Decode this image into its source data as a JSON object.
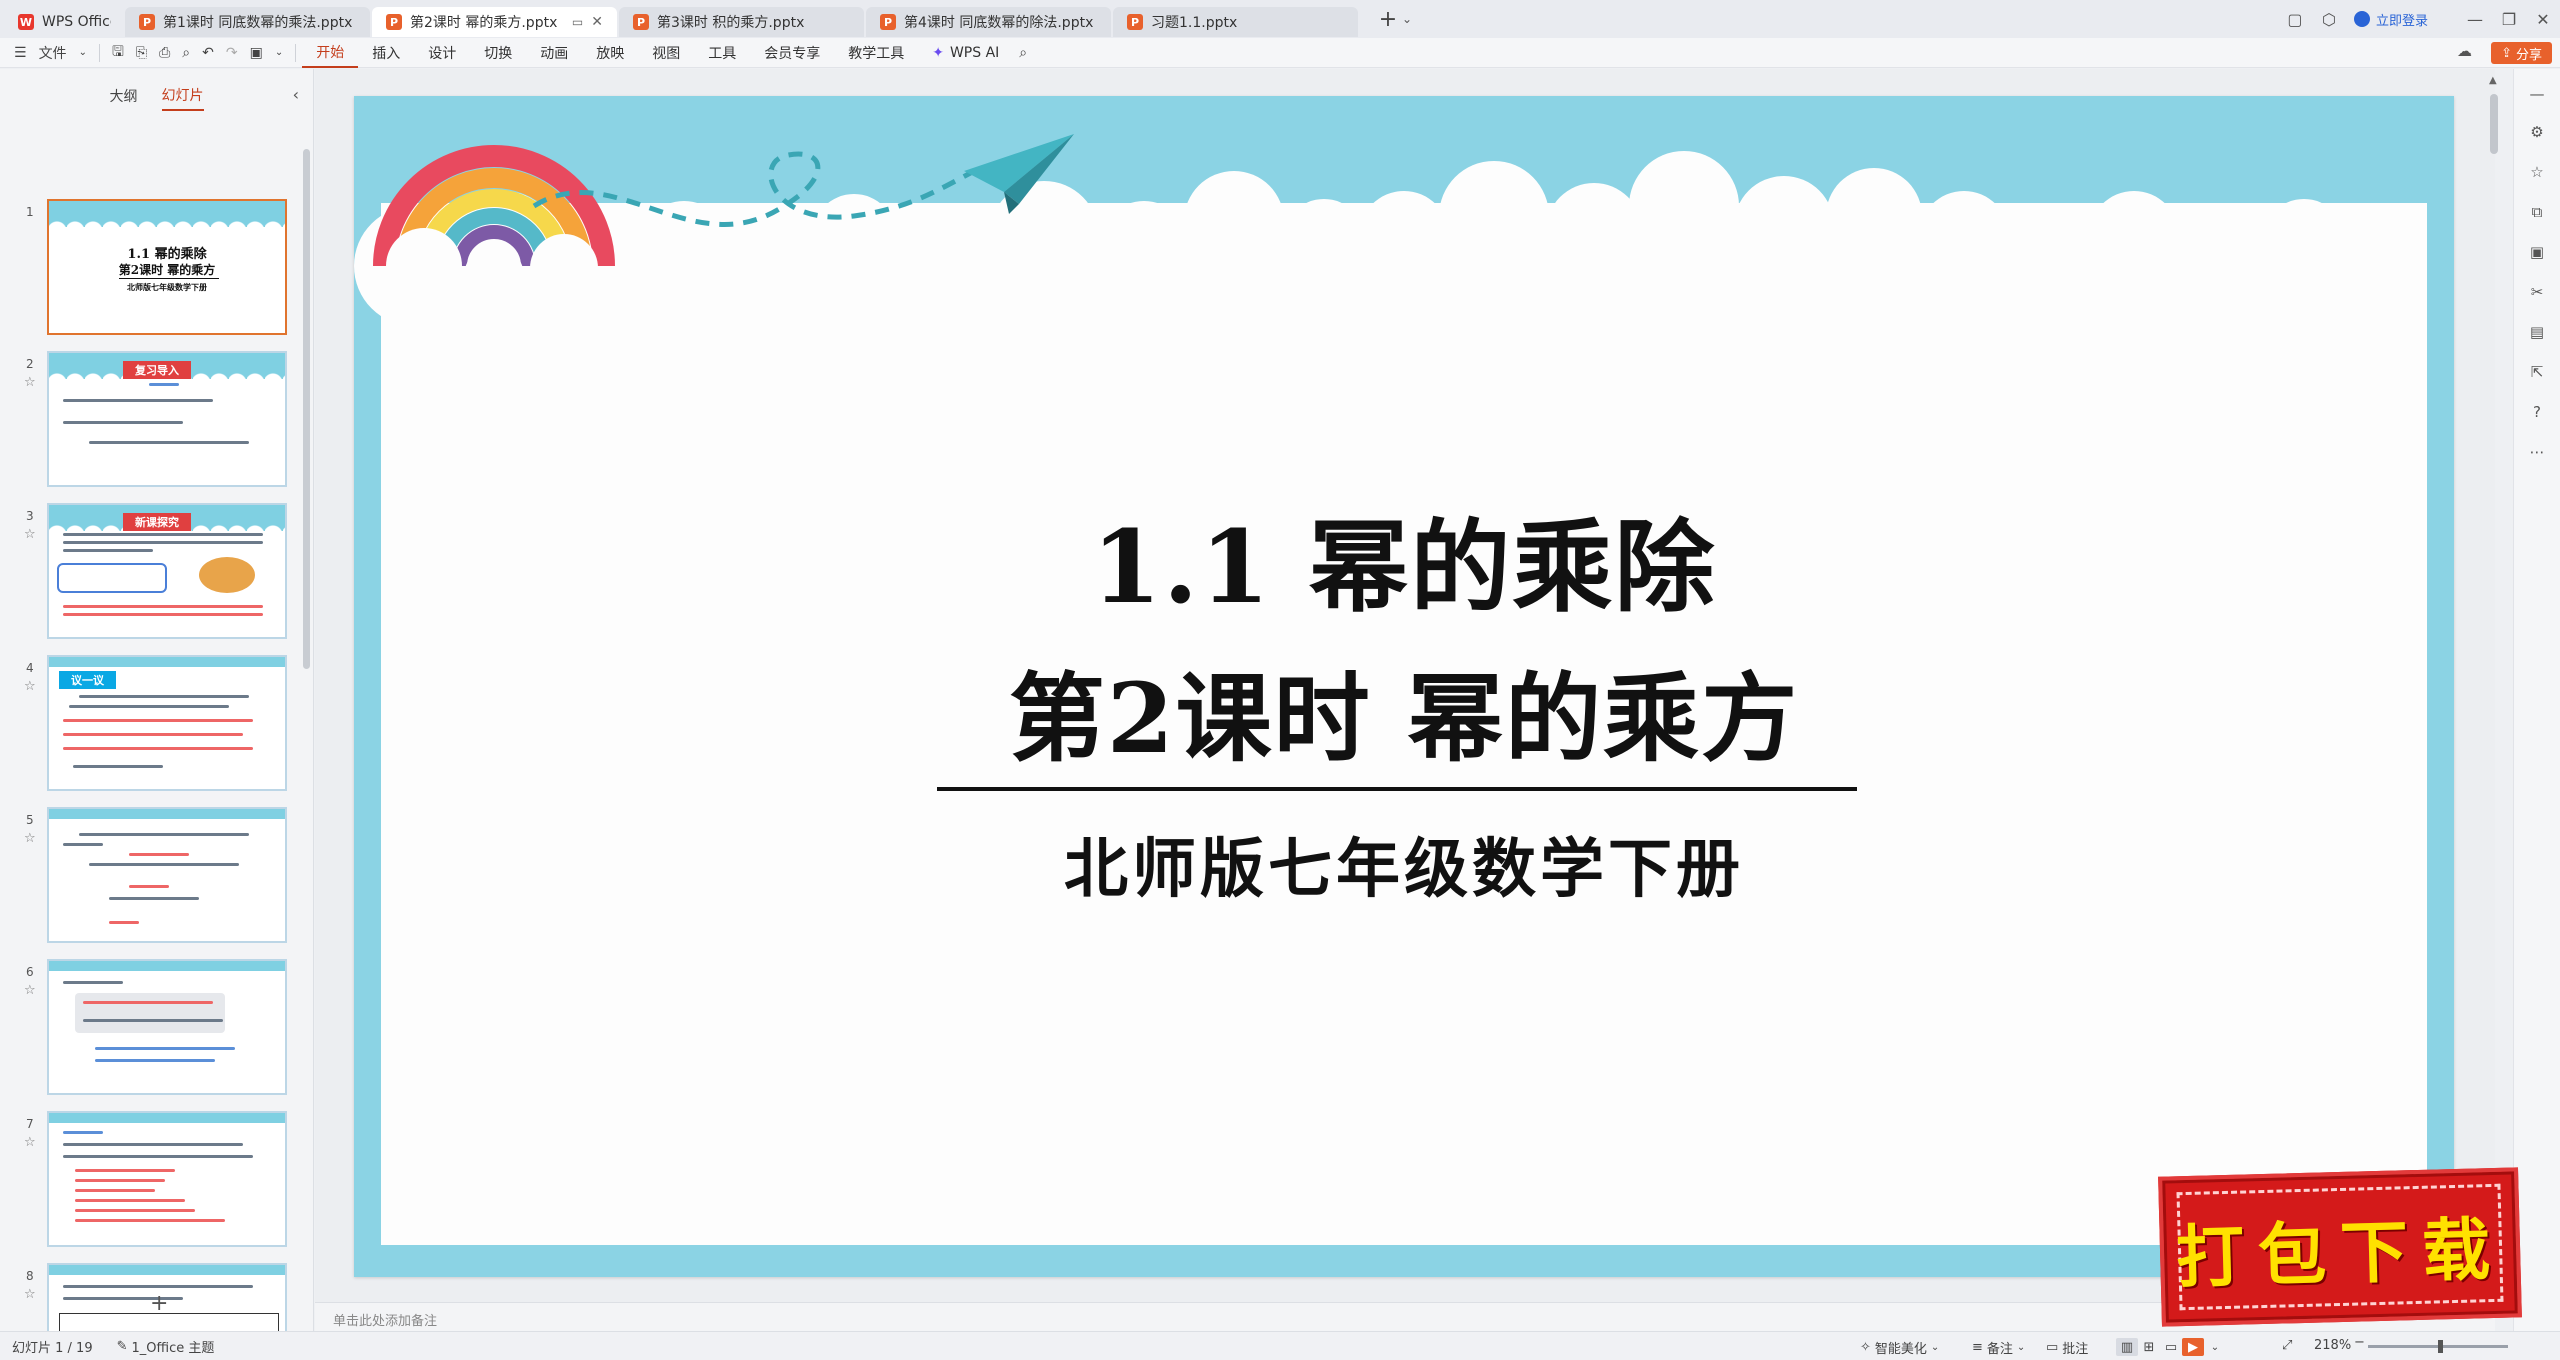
{
  "tabs": {
    "home_label": "WPS Office",
    "docs": [
      {
        "label": "第1课时 同底数幂的乘法.pptx",
        "active": false
      },
      {
        "label": "第2课时 幂的乘方.pptx",
        "active": true
      },
      {
        "label": "第3课时 积的乘方.pptx",
        "active": false
      },
      {
        "label": "第4课时 同底数幂的除法.pptx",
        "active": false
      },
      {
        "label": "习题1.1.pptx",
        "active": false
      }
    ],
    "add_label": "+",
    "login_label": "立即登录"
  },
  "menubar": {
    "file_label": "文件",
    "menus": [
      "开始",
      "插入",
      "设计",
      "切换",
      "动画",
      "放映",
      "视图",
      "工具",
      "会员专享",
      "教学工具"
    ],
    "active_menu": "开始",
    "wps_ai_label": "WPS AI",
    "share_label": "分享"
  },
  "left_panel": {
    "tab_outline": "大纲",
    "tab_slides": "幻灯片",
    "thumbnails": [
      {
        "num": "1",
        "t1": "1.1  幂的乘除",
        "t2": "第2课时  幂的乘方",
        "t3": "北师版七年级数学下册"
      },
      {
        "num": "2",
        "header": "复习导入"
      },
      {
        "num": "3",
        "header": "新课探究"
      },
      {
        "num": "4",
        "header": "议一议"
      },
      {
        "num": "5"
      },
      {
        "num": "6"
      },
      {
        "num": "7"
      },
      {
        "num": "8"
      }
    ],
    "add_slide": "+"
  },
  "slide": {
    "title_line1": "1.1  幂的乘除",
    "title_line2": "第2课时  幂的乘方",
    "subtitle": "北师版七年级数学下册",
    "sky_color": "#8bd3e4"
  },
  "notes": {
    "placeholder": "单击此处添加备注"
  },
  "status": {
    "slide_counter": "幻灯片 1 / 19",
    "theme": "1_Office 主题",
    "beautify": "智能美化",
    "notes_label": "备注",
    "comment_label": "批注",
    "zoom": "218%"
  },
  "watermark": {
    "text": "打包下载"
  }
}
